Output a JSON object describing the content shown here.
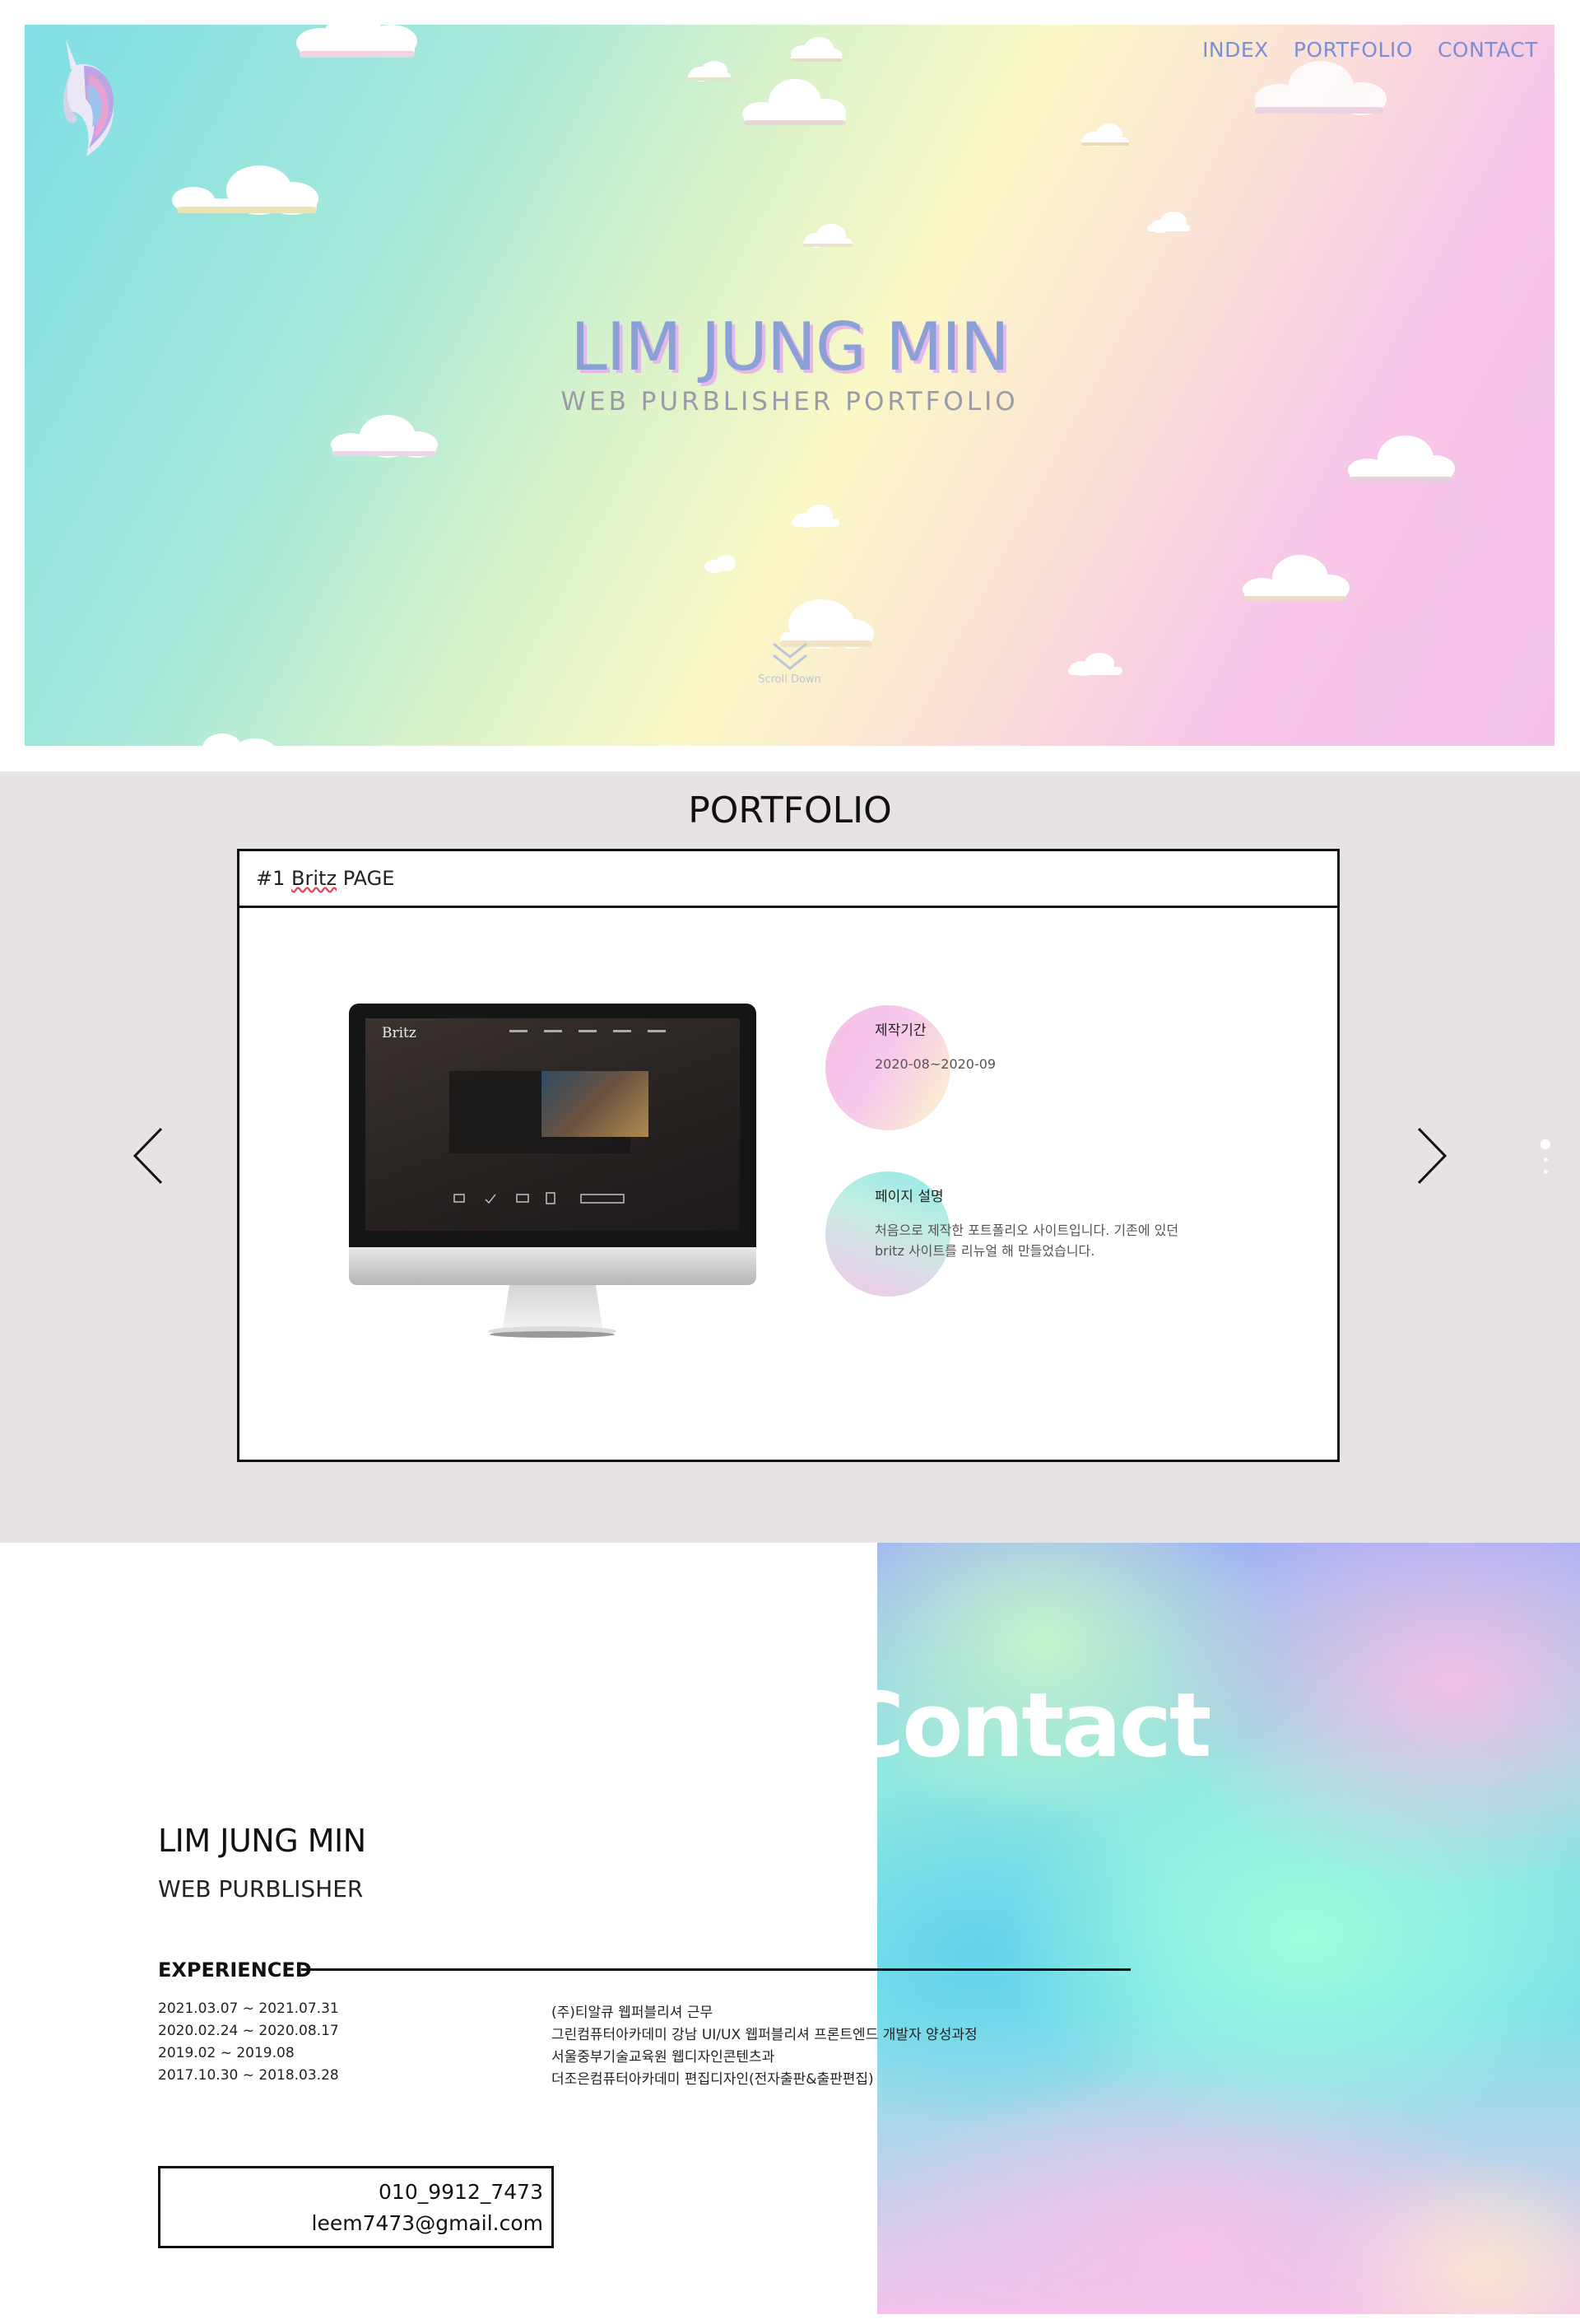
{
  "hero": {
    "nav": [
      "INDEX",
      "PORTFOLIO",
      "CONTACT"
    ],
    "title": "LIM JUNG MIN",
    "subtitle": "WEB PURBLISHER PORTFOLIO",
    "scroll_label": "Scroll Down"
  },
  "portfolio": {
    "heading": "PORTFOLIO",
    "card_number": "#1",
    "card_name": "Britz",
    "card_suffix": "PAGE",
    "screen_brand": "Britz",
    "period_label": "제작기간",
    "period_value": "2020-08~2020-09",
    "desc_label": "페이지 설명",
    "desc_value": "처음으로 제작한 포트폴리오 사이트입니다. 기존에 있던 britz 사이트를 리뉴얼 해 만들었습니다.",
    "slider_dots": 3,
    "active_dot": 1
  },
  "contact": {
    "big_word": "Contact",
    "name": "LIM JUNG MIN",
    "role": "WEB PURBLISHER",
    "experience_title": "EXPERIENCED",
    "experience": [
      {
        "date": "2021.03.07 ~ 2021.07.31",
        "desc": "(주)티알큐 웹퍼블리셔 근무"
      },
      {
        "date": "2020.02.24 ~ 2020.08.17",
        "desc": "그린컴퓨터아카데미 강남 UI/UX 웹퍼블리셔 프론트엔드 개발자 양성과정"
      },
      {
        "date": "2019.02 ~ 2019.08",
        "desc": "서울중부기술교육원 웹디자인콘텐츠과"
      },
      {
        "date": "2017.10.30 ~ 2018.03.28",
        "desc": "더조은컴퓨터아카데미 편집디자인(전자출판&출판편집)"
      }
    ],
    "phone": "010_9912_7473",
    "email": "leem7473@gmail.com"
  },
  "colors": {
    "nav": "#7b8ed6",
    "title": "#8aa0d6",
    "title_shadow": "#e6b8e8",
    "portfolio_bg": "#e7e3e4"
  },
  "icons": [
    "unicorn-logo-icon",
    "cloud-icon",
    "scroll-down-chevron-icon",
    "arrow-left-icon",
    "arrow-right-icon"
  ]
}
